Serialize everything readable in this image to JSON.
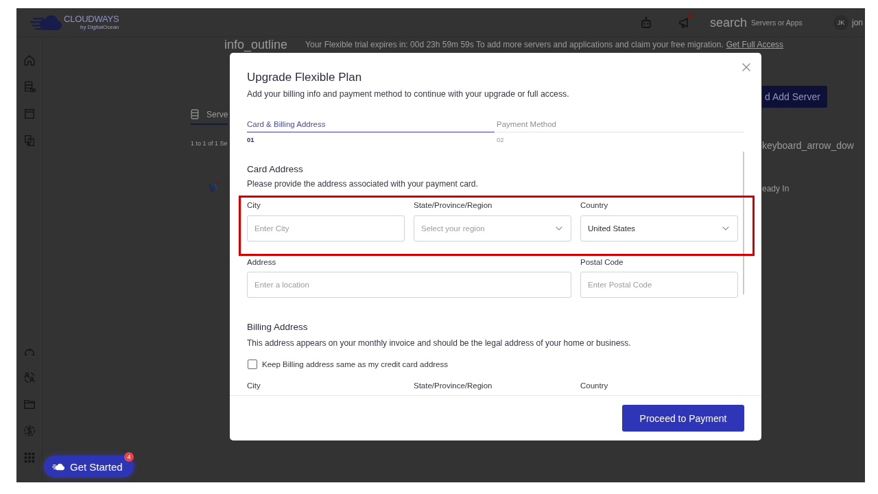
{
  "header": {
    "brand": "CLOUDWAYS",
    "brand_tagline": "by DigitalOcean",
    "notification": true,
    "search_label": "search",
    "search_placeholder": "Servers or Apps",
    "user_initials": "JK",
    "user_name": "jon"
  },
  "banner": {
    "icon_label": "info_outline",
    "message": "Your Flexible trial expires in: 00d 23h 59m 59s To add more servers and applications and claim your free migration.",
    "link": "Get Full Access"
  },
  "servers_panel": {
    "tab": "Serve",
    "count": "1 to 1 of 1 Se"
  },
  "right_panel": {
    "button": "d Add Server",
    "dropdown": "keyboard_arrow_dow",
    "status": "eady In"
  },
  "modal": {
    "title": "Upgrade Flexible Plan",
    "subtitle": "Add your billing info and payment method to continue with your upgrade or full access.",
    "steps": [
      {
        "label": "Card & Billing Address",
        "number": "01",
        "selected": true
      },
      {
        "label": "Payment Method",
        "number": "02",
        "selected": false
      }
    ],
    "sections": [
      {
        "heading": "Card Address",
        "description": "Please provide the address associated with your payment card.",
        "rows": [
          {
            "highlighted": true,
            "fields": [
              {
                "kind": "text",
                "label": "City",
                "placeholder": "Enter City"
              },
              {
                "kind": "select",
                "label": "State/Province/Region",
                "placeholder": "Select your region"
              },
              {
                "kind": "select",
                "label": "Country",
                "value": "United States"
              }
            ]
          },
          {
            "highlighted": false,
            "fields": [
              {
                "kind": "text",
                "label": "Address",
                "placeholder": "Enter a location"
              },
              {
                "kind": "text",
                "label": "Postal Code",
                "placeholder": "Enter Postal Code"
              }
            ]
          }
        ]
      },
      {
        "heading": "Billing Address",
        "description": "This address appears on your monthly invoice and should be the legal address of your home or business.",
        "same_address": {
          "label": "Keep Billing address same as my credit card address",
          "checked": false
        },
        "rows": [
          {
            "highlighted": false,
            "fields": [
              {
                "kind": "label",
                "label": "City"
              },
              {
                "kind": "label",
                "label": "State/Province/Region"
              },
              {
                "kind": "label",
                "label": "Country"
              }
            ]
          }
        ]
      }
    ],
    "primary_button": "Proceed to Payment"
  },
  "get_started": {
    "label": "Get Started",
    "badge": "4"
  }
}
